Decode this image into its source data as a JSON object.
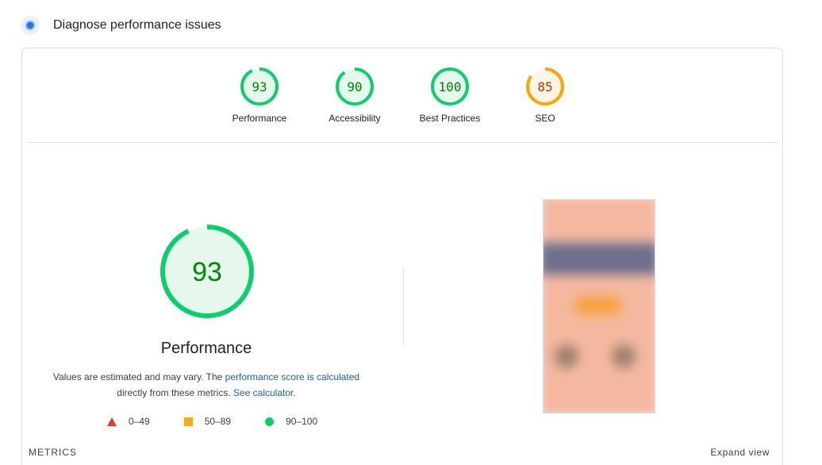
{
  "header": {
    "title": "Diagnose performance issues",
    "icon": "speed-gauge-icon"
  },
  "scores": [
    {
      "label": "Performance",
      "value": "93",
      "score": 93,
      "color": "#0cce6b",
      "fill": "#e6f8ee",
      "text_color": "#008800"
    },
    {
      "label": "Accessibility",
      "value": "90",
      "score": 90,
      "color": "#0cce6b",
      "fill": "#e6f8ee",
      "text_color": "#008800"
    },
    {
      "label": "Best Practices",
      "value": "100",
      "score": 100,
      "color": "#0cce6b",
      "fill": "#e6f8ee",
      "text_color": "#008800"
    },
    {
      "label": "SEO",
      "value": "85",
      "score": 85,
      "color": "#ffa400",
      "fill": "#fff5e6",
      "text_color": "#c33300"
    }
  ],
  "main": {
    "score": "93",
    "score_value": 93,
    "title": "Performance",
    "description_prefix": "Values are estimated and may vary. The ",
    "link_score": "performance score is calculated",
    "description_middle": "directly from these metrics. ",
    "link_calculator": "See calculator",
    "description_suffix": "."
  },
  "legend": [
    {
      "shape": "triangle",
      "range": "0–49",
      "color": "#e53935"
    },
    {
      "shape": "square",
      "range": "50–89",
      "color": "#f9a825"
    },
    {
      "shape": "circle",
      "range": "90–100",
      "color": "#0cce6b"
    }
  ],
  "footer": {
    "metrics_label": "METRICS",
    "expand_label": "Expand view"
  },
  "colors": {
    "pass": "#0cce6b",
    "average": "#ffa400",
    "fail": "#e53935",
    "link": "#1a5fb4"
  }
}
